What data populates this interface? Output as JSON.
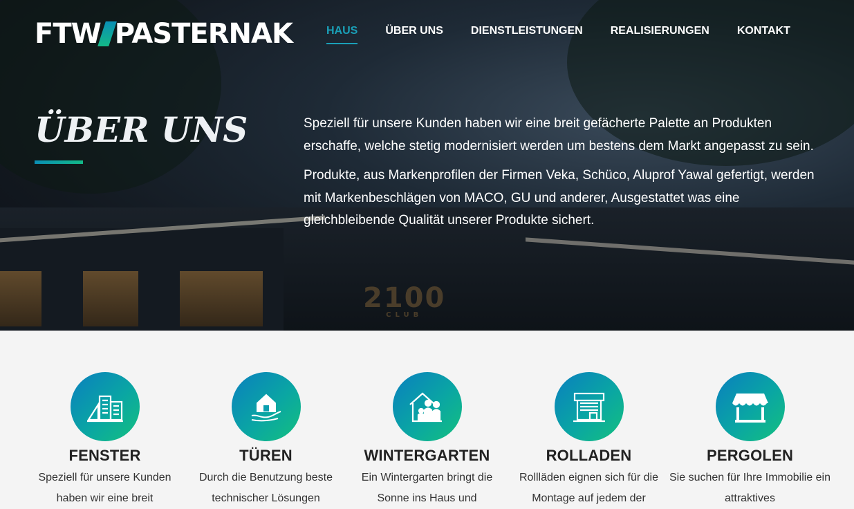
{
  "brand": {
    "name_left": "FTW",
    "name_right": "PASTERNAK"
  },
  "nav": [
    {
      "label": "HAUS",
      "active": true
    },
    {
      "label": "ÜBER UNS",
      "active": false
    },
    {
      "label": "DIENSTLEISTUNGEN",
      "active": false
    },
    {
      "label": "REALISIERUNGEN",
      "active": false
    },
    {
      "label": "KONTAKT",
      "active": false
    }
  ],
  "hero": {
    "title": "ÜBER UNS",
    "sign_number": "2100",
    "sign_text": "CLUB",
    "paragraphs": [
      "Speziell für unsere Kunden haben wir eine breit gefächerte Palette an Produkten erschaffe, welche stetig modernisiert werden um bestens dem Markt angepasst zu sein.",
      "Produkte, aus Markenprofilen der Firmen Veka, Schüco, Aluprof Yawal gefertigt, werden mit Markenbeschlägen von MACO, GU und anderer, Ausgestattet was eine gleichbleibende Qualität unserer Produkte sichert."
    ]
  },
  "features": [
    {
      "title": "FENSTER",
      "icon": "building-icon",
      "text": "Speziell für unsere Kunden haben wir eine breit"
    },
    {
      "title": "TÜREN",
      "icon": "house-in-hand-icon",
      "text": "Durch die Benutzung beste technischer Lösungen"
    },
    {
      "title": "WINTERGARTEN",
      "icon": "family-house-icon",
      "text": "Ein Wintergarten bringt die Sonne ins Haus und"
    },
    {
      "title": "ROLLADEN",
      "icon": "shop-shutter-icon",
      "text": "Rollläden eignen sich für die Montage auf jedem der"
    },
    {
      "title": "PERGOLEN",
      "icon": "awning-icon",
      "text": "Sie suchen für Ihre Immobilie ein attraktives"
    }
  ],
  "colors": {
    "accent": "#1aa0b8",
    "gradient_start": "#0a7fbf",
    "gradient_end": "#14c07e"
  }
}
